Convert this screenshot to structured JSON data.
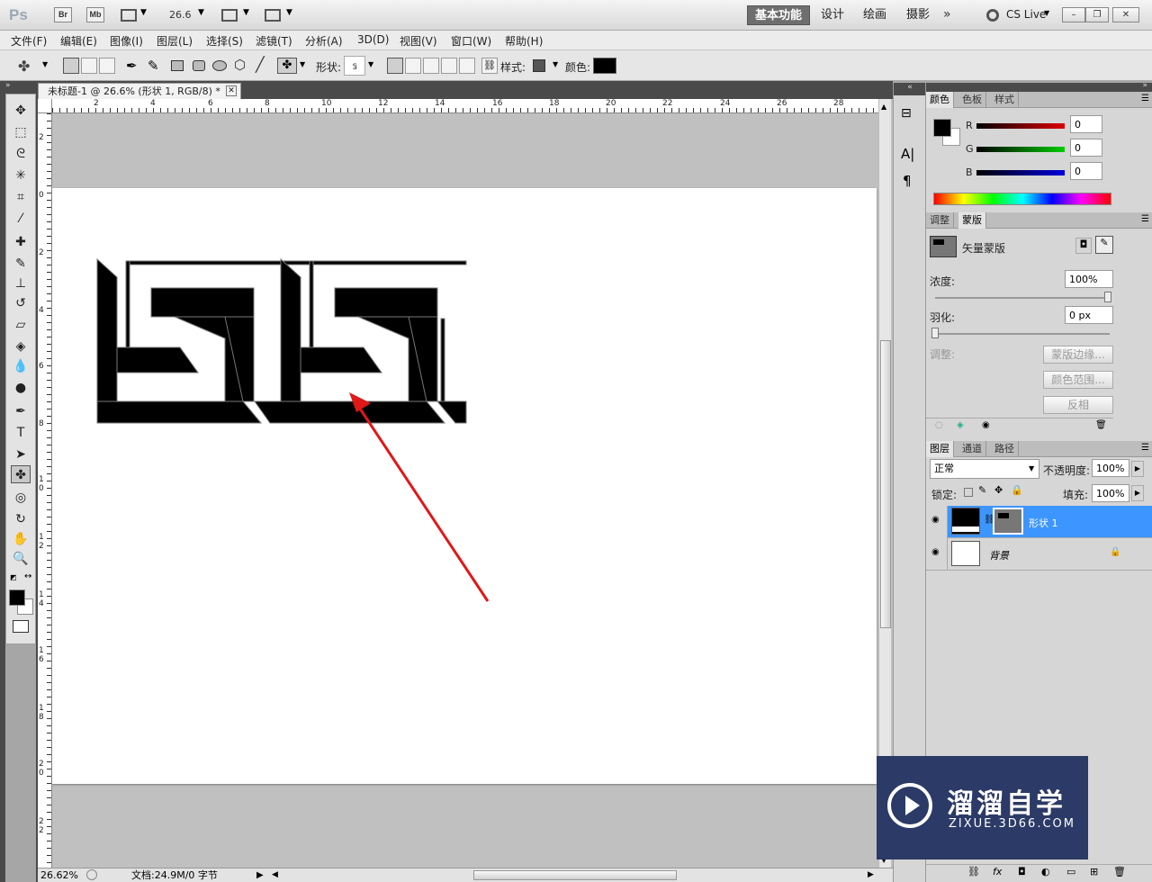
{
  "app": {
    "logo": "Ps",
    "bridge": "Br",
    "minibridge": "Mb",
    "zoom": "26.6",
    "workspaces": [
      "基本功能",
      "设计",
      "绘画",
      "摄影"
    ],
    "active_workspace": "基本功能",
    "cslive": "CS Live"
  },
  "menu": [
    "文件(F)",
    "编辑(E)",
    "图像(I)",
    "图层(L)",
    "选择(S)",
    "滤镜(T)",
    "分析(A)",
    "3D(D)",
    "视图(V)",
    "窗口(W)",
    "帮助(H)"
  ],
  "options": {
    "shape_label": "形状:",
    "style_label": "样式:",
    "color_label": "颜色:",
    "color_value": "#000000"
  },
  "document": {
    "tab_title": "未标题-1 @ 26.6% (形状 1, RGB/8) *",
    "h_ruler": [
      "2",
      "4",
      "6",
      "8",
      "10",
      "12",
      "14",
      "16",
      "18",
      "20",
      "22",
      "24",
      "26",
      "28"
    ],
    "v_ruler": [
      "2",
      "0",
      "2",
      "4",
      "6",
      "8",
      "10",
      "12",
      "14",
      "16",
      "18",
      "20",
      "22"
    ],
    "zoom_status": "26.62%",
    "doc_status": "文档:24.9M/0 字节"
  },
  "color_panel": {
    "tabs": [
      "颜色",
      "色板",
      "样式"
    ],
    "channels": [
      {
        "name": "R",
        "value": "0",
        "color": "#cc0000"
      },
      {
        "name": "G",
        "value": "0",
        "color": "#00b000"
      },
      {
        "name": "B",
        "value": "0",
        "color": "#0000cc"
      }
    ]
  },
  "masks_panel": {
    "tabs": [
      "调整",
      "蒙版"
    ],
    "title": "矢量蒙版",
    "density_label": "浓度:",
    "density_value": "100%",
    "feather_label": "羽化:",
    "feather_value": "0 px",
    "adjust_label": "调整:",
    "buttons": [
      "蒙版边缘...",
      "颜色范围...",
      "反相"
    ]
  },
  "layers_panel": {
    "tabs": [
      "图层",
      "通道",
      "路径"
    ],
    "blend_mode": "正常",
    "opacity_label": "不透明度:",
    "opacity_value": "100%",
    "lock_label": "锁定:",
    "fill_label": "填充:",
    "fill_value": "100%",
    "layers": [
      {
        "name": "形状 1",
        "selected": true
      },
      {
        "name": "背景",
        "selected": false
      }
    ]
  },
  "watermark": {
    "title": "溜溜自学",
    "subtitle": "ZIXUE.3D66.COM"
  }
}
